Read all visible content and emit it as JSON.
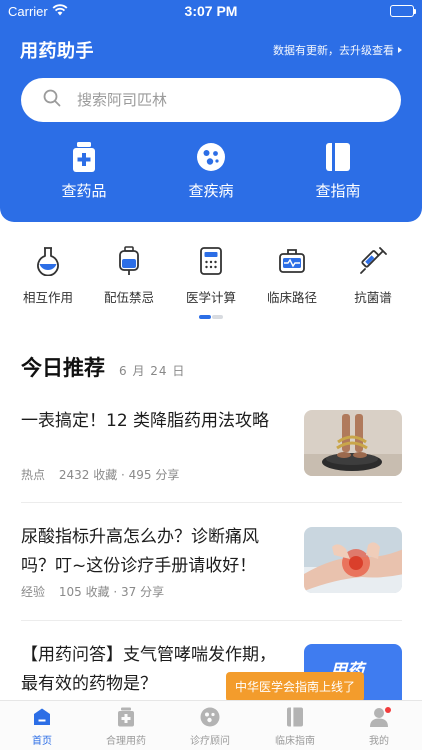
{
  "status": {
    "carrier": "Carrier",
    "time": "3:07 PM"
  },
  "header": {
    "title": "用药助手",
    "update_notice": "数据有更新，去升级查看"
  },
  "search": {
    "placeholder": "搜索阿司匹林"
  },
  "main_tools": [
    {
      "label": "查药品",
      "icon": "medicine-bottle-icon"
    },
    {
      "label": "查疾病",
      "icon": "virus-icon"
    },
    {
      "label": "查指南",
      "icon": "guide-book-icon"
    }
  ],
  "shortcuts": [
    {
      "label": "相互作用",
      "icon": "flask-icon"
    },
    {
      "label": "配伍禁忌",
      "icon": "iv-bag-icon"
    },
    {
      "label": "医学计算",
      "icon": "calculator-icon"
    },
    {
      "label": "临床路径",
      "icon": "medical-kit-icon"
    },
    {
      "label": "抗菌谱",
      "icon": "syringe-icon"
    }
  ],
  "pager": {
    "current": 1,
    "total": 2
  },
  "recommend": {
    "title": "今日推荐",
    "date": "6 月 24 日",
    "articles": [
      {
        "title": "一表搞定！12 类降脂药用法攻略",
        "tag": "热点",
        "stats": "2432 收藏 · 495 分享",
        "thumb": "scale-feet-photo"
      },
      {
        "title": "尿酸指标升高怎么办？诊断痛风吗？叮~这份诊疗手册请收好！",
        "tag": "经验",
        "stats": "105 收藏 · 37 分享",
        "thumb": "knee-pain-photo"
      },
      {
        "title": "【用药问答】支气管哮喘发作期，最有效的药物是？",
        "tag": "",
        "stats": "",
        "thumb": "drug-qa-card",
        "thumb_text": "用药"
      }
    ]
  },
  "toast": {
    "text": "中华医学会指南上线了"
  },
  "tabbar": [
    {
      "label": "首页",
      "icon": "home-icon",
      "active": true
    },
    {
      "label": "合理用药",
      "icon": "medicine-icon",
      "active": false
    },
    {
      "label": "诊疗顾问",
      "icon": "consult-icon",
      "active": false
    },
    {
      "label": "临床指南",
      "icon": "guide-icon",
      "active": false
    },
    {
      "label": "我的",
      "icon": "profile-icon",
      "active": false,
      "badge": true
    }
  ],
  "colors": {
    "primary": "#2c6ee6",
    "toast": "#f39c2c",
    "badge": "#f23c3c"
  }
}
